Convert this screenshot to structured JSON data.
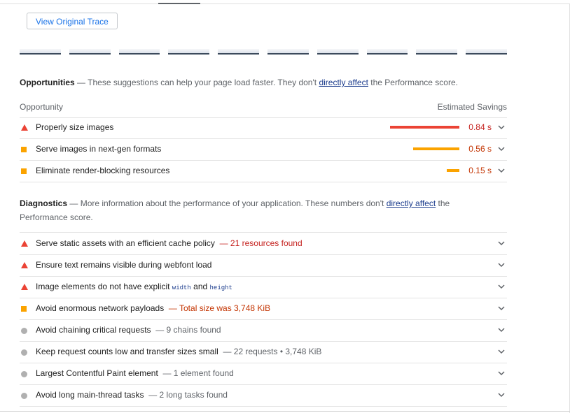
{
  "toolbar": {
    "view_trace_label": "View Original Trace"
  },
  "opportunities": {
    "heading": "Opportunities",
    "dash": "—",
    "desc_before": "These suggestions can help your page load faster. They don't",
    "link": "directly affect",
    "desc_after": "the Performance score.",
    "col_left": "Opportunity",
    "col_right": "Estimated Savings",
    "items": [
      {
        "label": "Properly size images",
        "savings": "0.84 s",
        "savings_fraction": 1.0,
        "severity": "fail"
      },
      {
        "label": "Serve images in next-gen formats",
        "savings": "0.56 s",
        "savings_fraction": 0.67,
        "severity": "average"
      },
      {
        "label": "Eliminate render-blocking resources",
        "savings": "0.15 s",
        "savings_fraction": 0.18,
        "severity": "average"
      }
    ]
  },
  "diagnostics": {
    "heading": "Diagnostics",
    "dash": "—",
    "desc_before": "More information about the performance of your application. These numbers don't",
    "link": "directly affect",
    "desc_after": "the",
    "desc_line2": "Performance score.",
    "items": [
      {
        "label": "Serve static assets with an efficient cache policy",
        "detail": "— 21 resources found",
        "severity": "fail"
      },
      {
        "label": "Ensure text remains visible during webfont load",
        "detail": "",
        "severity": "fail"
      },
      {
        "label": "Image elements do not have explicit",
        "code1": "width",
        "and": "and",
        "code2": "height",
        "severity": "fail"
      },
      {
        "label": "Avoid enormous network payloads",
        "detail": "— Total size was 3,748 KiB",
        "severity": "average"
      },
      {
        "label": "Avoid chaining critical requests",
        "detail": "— 9 chains found",
        "severity": "info"
      },
      {
        "label": "Keep request counts low and transfer sizes small",
        "detail": "— 22 requests • 3,748 KiB",
        "severity": "info"
      },
      {
        "label": "Largest Contentful Paint element",
        "detail": "— 1 element found",
        "severity": "info"
      },
      {
        "label": "Avoid long main-thread tasks",
        "detail": "— 2 long tasks found",
        "severity": "info"
      }
    ]
  },
  "colors": {
    "fail": "#eb4335",
    "average": "#fba300",
    "info": "#b0b0b0",
    "fail_text": "#c5221f",
    "average_text": "#c33300",
    "link": "#1a3b8c"
  }
}
